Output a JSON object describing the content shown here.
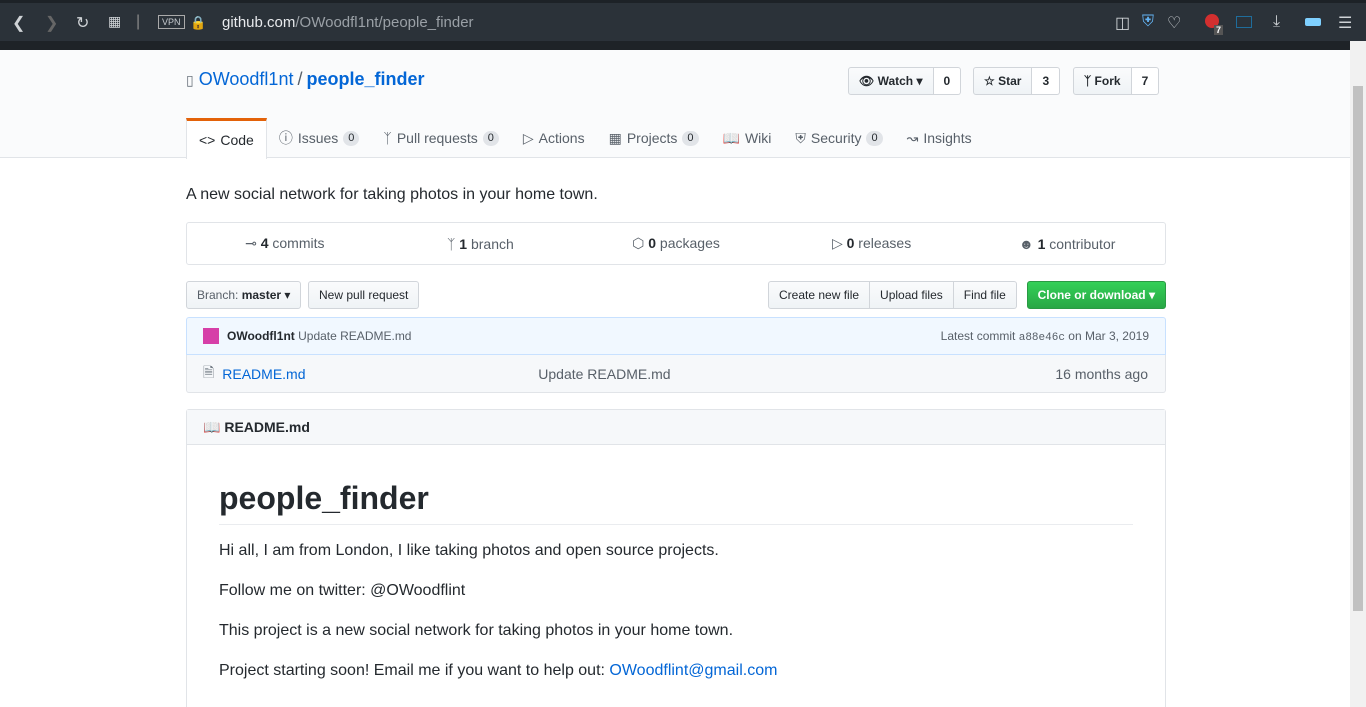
{
  "browser": {
    "url_host": "github.com",
    "url_path": "/OWoodfl1nt/people_finder",
    "vpn": "VPN",
    "adblock_count": "7"
  },
  "repo": {
    "owner": "OWoodfl1nt",
    "sep": "/",
    "name": "people_finder",
    "watch": "Watch",
    "watch_count": "0",
    "star": "Star",
    "star_count": "3",
    "fork": "Fork",
    "fork_count": "7"
  },
  "tabs": [
    {
      "label": "Code"
    },
    {
      "label": "Issues",
      "count": "0"
    },
    {
      "label": "Pull requests",
      "count": "0"
    },
    {
      "label": "Actions"
    },
    {
      "label": "Projects",
      "count": "0"
    },
    {
      "label": "Wiki"
    },
    {
      "label": "Security",
      "count": "0"
    },
    {
      "label": "Insights"
    }
  ],
  "description": "A new social network for taking photos in your home town.",
  "summary": [
    {
      "n": "4",
      "l": "commits"
    },
    {
      "n": "1",
      "l": "branch"
    },
    {
      "n": "0",
      "l": "packages"
    },
    {
      "n": "0",
      "l": "releases"
    },
    {
      "n": "1",
      "l": "contributor"
    }
  ],
  "toolbar": {
    "branch_label": "Branch:",
    "branch": "master",
    "new_pr": "New pull request",
    "create": "Create new file",
    "upload": "Upload files",
    "find": "Find file",
    "clone": "Clone or download"
  },
  "commit": {
    "author": "OWoodfl1nt",
    "message": "Update README.md",
    "latest": "Latest commit",
    "sha": "a88e46c",
    "date": "on Mar 3, 2019"
  },
  "files": [
    {
      "name": "README.md",
      "message": "Update README.md",
      "age": "16 months ago"
    }
  ],
  "readme": {
    "header": "README.md",
    "title": "people_finder",
    "p1": "Hi all, I am from London, I like taking photos and open source projects.",
    "p2": "Follow me on twitter: @OWoodflint",
    "p3": "This project is a new social network for taking photos in your home town.",
    "p4": "Project starting soon! Email me if you want to help out: ",
    "email": "OWoodflint@gmail.com"
  }
}
